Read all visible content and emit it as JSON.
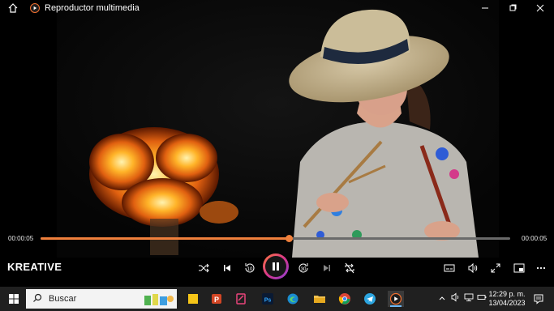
{
  "window": {
    "title": "Reproductor multimedia",
    "controls": [
      "minimize-icon",
      "maximize-icon",
      "close-icon"
    ]
  },
  "player": {
    "media_title": "KREATIVE",
    "current_time": "00:00:05",
    "remaining_time": "00:00:05",
    "progress": 0.53,
    "accent_color": "#f0803c",
    "buttons": [
      "shuffle-icon",
      "previous-icon",
      "rewind-10-icon",
      "pause-icon",
      "forward-30-icon",
      "next-icon",
      "repeat-off-icon",
      "subtitles-icon",
      "volume-icon",
      "fullscreen-icon",
      "mini-player-icon",
      "more-icon"
    ],
    "rewind_label": "10",
    "forward_label": "30"
  },
  "taskbar": {
    "search_placeholder": "Buscar",
    "clock_time": "12:29 p. m.",
    "clock_date": "13/04/2023",
    "apps": [
      "sticky-notes-icon",
      "powerpoint-icon",
      "snip-icon",
      "photoshop-icon",
      "edge-icon",
      "file-explorer-icon",
      "chrome-icon",
      "telegram-icon",
      "media-player-icon"
    ]
  }
}
